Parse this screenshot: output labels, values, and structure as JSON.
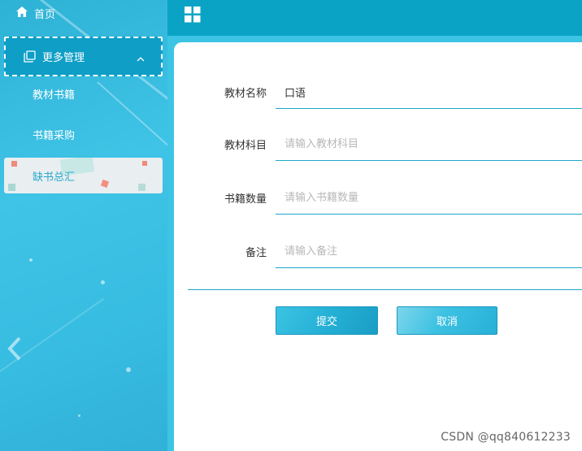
{
  "sidebar": {
    "home_label": "首页",
    "group_label": "更多管理",
    "items": [
      {
        "label": "教材书籍"
      },
      {
        "label": "书籍采购"
      },
      {
        "label": "缺书总汇"
      }
    ]
  },
  "form": {
    "fields": [
      {
        "label": "教材名称",
        "value": "口语",
        "placeholder": ""
      },
      {
        "label": "教材科目",
        "value": "",
        "placeholder": "请输入教材科目"
      },
      {
        "label": "书籍数量",
        "value": "",
        "placeholder": "请输入书籍数量"
      },
      {
        "label": "备注",
        "value": "",
        "placeholder": "请输入备注"
      }
    ],
    "submit_label": "提交",
    "cancel_label": "取消"
  },
  "watermark": "CSDN @qq840612233",
  "colors": {
    "accent": "#1fa8cb",
    "topbar": "#0aa3c6",
    "sidebar": "#3cc4e4",
    "active_text": "#29a9cc"
  }
}
